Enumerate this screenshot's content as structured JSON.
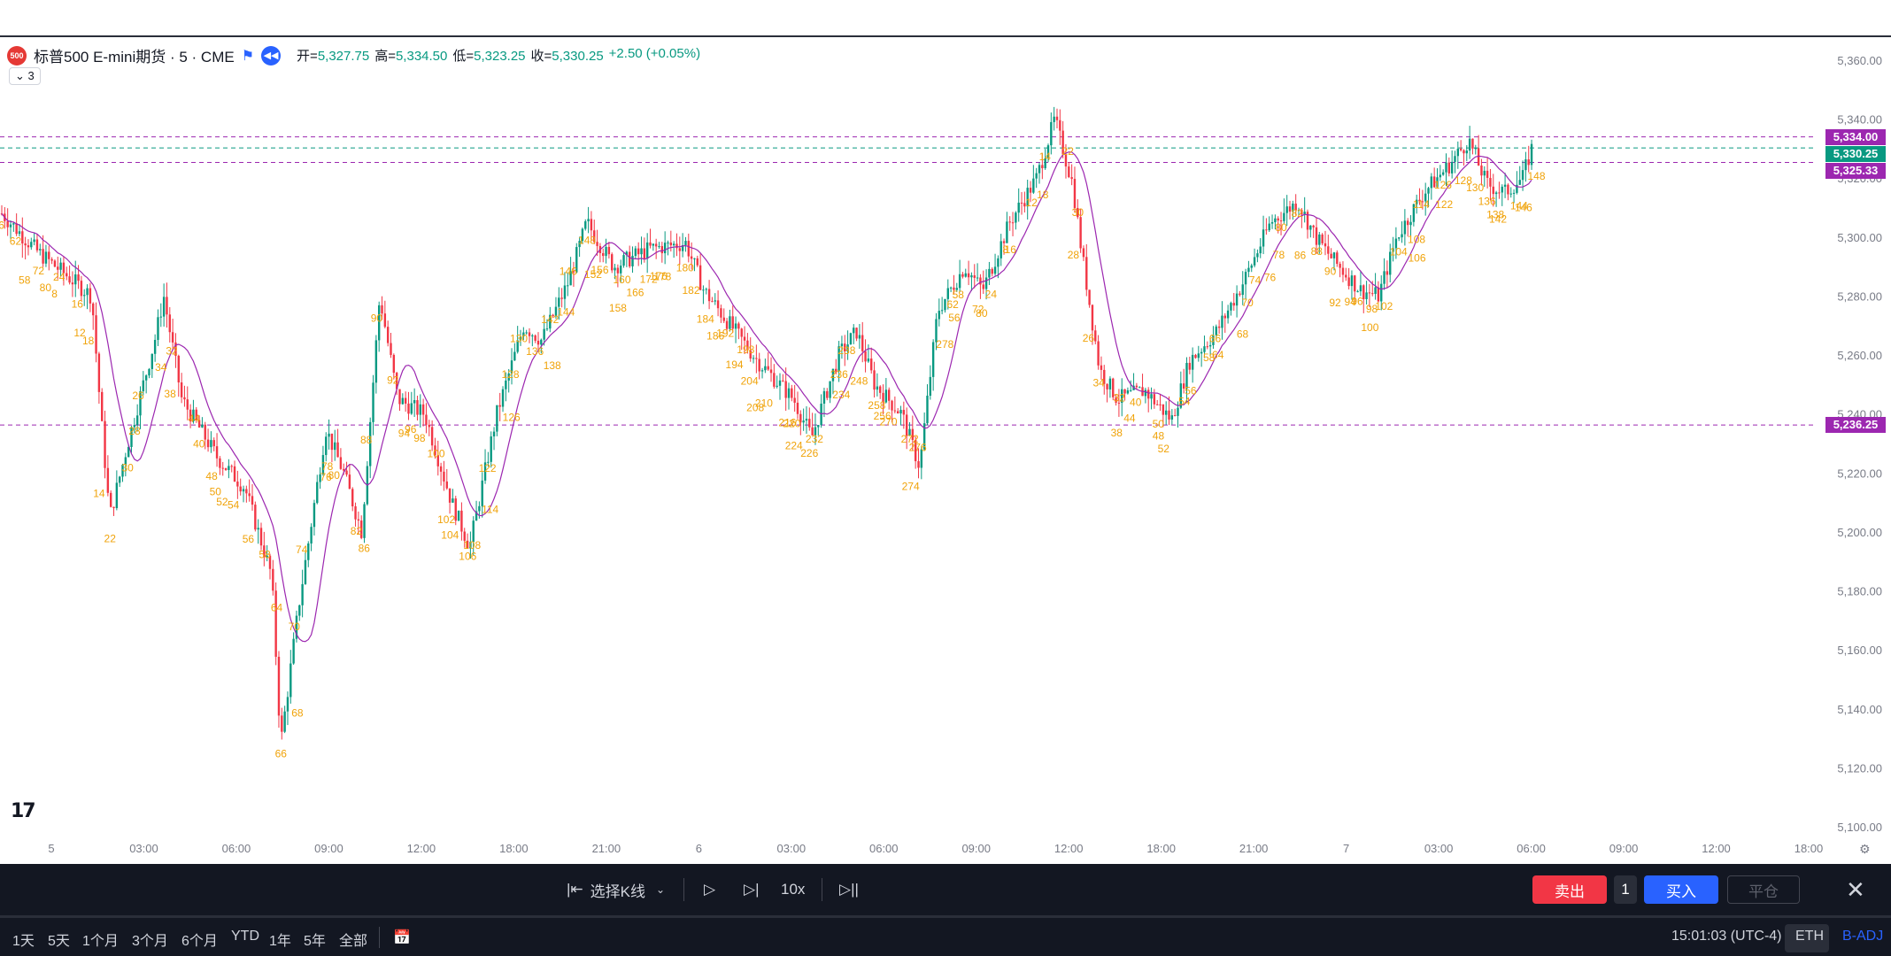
{
  "legend": {
    "symbol_badge": "500",
    "symbol_title": "标普500 E-mini期货 · 5 · CME",
    "open_label": "开=",
    "open": "5,327.75",
    "high_label": "高=",
    "high": "5,334.50",
    "low_label": "低=",
    "low": "5,323.25",
    "close_label": "收=",
    "close": "5,330.25",
    "change": "+2.50 (+0.05%)",
    "indicator_toggle": "⌄ 3"
  },
  "chart_data": {
    "type": "candlestick",
    "symbol": "标普500 E-mini期货",
    "interval": "5",
    "exchange": "CME",
    "y_axis_ticks": [
      "5,360.00",
      "5,340.00",
      "5,320.00",
      "5,300.00",
      "5,280.00",
      "5,260.00",
      "5,240.00",
      "5,220.00",
      "5,200.00",
      "5,180.00",
      "5,160.00",
      "5,140.00",
      "5,120.00",
      "5,100.00"
    ],
    "y_tick_values": [
      5360,
      5340,
      5320,
      5300,
      5280,
      5260,
      5240,
      5220,
      5200,
      5180,
      5160,
      5140,
      5120,
      5100
    ],
    "ylim": [
      5100,
      5360
    ],
    "x_axis_ticks": [
      "5",
      "03:00",
      "06:00",
      "09:00",
      "12:00",
      "18:00",
      "21:00",
      "6",
      "03:00",
      "06:00",
      "09:00",
      "12:00",
      "18:00",
      "21:00",
      "7",
      "03:00",
      "06:00",
      "09:00",
      "12:00",
      "18:00"
    ],
    "price_key_points": [
      [
        0,
        5308
      ],
      [
        0.02,
        5295
      ],
      [
        0.05,
        5280
      ],
      [
        0.055,
        5240
      ],
      [
        0.06,
        5205
      ],
      [
        0.07,
        5230
      ],
      [
        0.085,
        5265
      ],
      [
        0.09,
        5280
      ],
      [
        0.1,
        5245
      ],
      [
        0.12,
        5225
      ],
      [
        0.135,
        5215
      ],
      [
        0.15,
        5185
      ],
      [
        0.155,
        5128
      ],
      [
        0.165,
        5175
      ],
      [
        0.18,
        5235
      ],
      [
        0.19,
        5220
      ],
      [
        0.2,
        5200
      ],
      [
        0.21,
        5280
      ],
      [
        0.22,
        5245
      ],
      [
        0.235,
        5240
      ],
      [
        0.25,
        5210
      ],
      [
        0.26,
        5195
      ],
      [
        0.275,
        5240
      ],
      [
        0.29,
        5270
      ],
      [
        0.3,
        5265
      ],
      [
        0.315,
        5285
      ],
      [
        0.325,
        5305
      ],
      [
        0.34,
        5290
      ],
      [
        0.36,
        5296
      ],
      [
        0.38,
        5298
      ],
      [
        0.39,
        5282
      ],
      [
        0.405,
        5270
      ],
      [
        0.42,
        5258
      ],
      [
        0.44,
        5245
      ],
      [
        0.45,
        5232
      ],
      [
        0.465,
        5260
      ],
      [
        0.475,
        5268
      ],
      [
        0.485,
        5250
      ],
      [
        0.5,
        5240
      ],
      [
        0.51,
        5222
      ],
      [
        0.52,
        5275
      ],
      [
        0.535,
        5290
      ],
      [
        0.545,
        5282
      ],
      [
        0.56,
        5305
      ],
      [
        0.575,
        5320
      ],
      [
        0.585,
        5340
      ],
      [
        0.595,
        5318
      ],
      [
        0.6,
        5295
      ],
      [
        0.61,
        5255
      ],
      [
        0.62,
        5245
      ],
      [
        0.635,
        5248
      ],
      [
        0.65,
        5238
      ],
      [
        0.66,
        5258
      ],
      [
        0.675,
        5268
      ],
      [
        0.69,
        5285
      ],
      [
        0.705,
        5305
      ],
      [
        0.72,
        5312
      ],
      [
        0.73,
        5300
      ],
      [
        0.74,
        5292
      ],
      [
        0.755,
        5282
      ],
      [
        0.765,
        5280
      ],
      [
        0.775,
        5300
      ],
      [
        0.79,
        5315
      ],
      [
        0.805,
        5325
      ],
      [
        0.815,
        5333
      ],
      [
        0.825,
        5318
      ],
      [
        0.835,
        5315
      ],
      [
        0.845,
        5320
      ],
      [
        0.85,
        5330
      ]
    ],
    "horizontal_levels": [
      {
        "label": "5,334.00",
        "value": 5334,
        "color": "#9c27b0"
      },
      {
        "label": "5,330.25",
        "value": 5330.25,
        "color": "#089981"
      },
      {
        "label": "5,325.33",
        "value": 5325.33,
        "color": "#9c27b0"
      },
      {
        "label": "5,236.25",
        "value": 5236.25,
        "color": "#9c27b0"
      }
    ],
    "moving_average_color": "#9c27b0",
    "footprint_label_color": "#f0a30a",
    "footprint_labels": [
      "56",
      "62",
      "58",
      "72",
      "80",
      "24",
      "8",
      "16",
      "12",
      "18",
      "14",
      "22",
      "30",
      "28",
      "26",
      "34",
      "32",
      "38",
      "44",
      "40",
      "48",
      "50",
      "52",
      "54",
      "56",
      "58",
      "64",
      "66",
      "68",
      "70",
      "74",
      "76",
      "78",
      "80",
      "82",
      "86",
      "88",
      "90",
      "92",
      "94",
      "96",
      "98",
      "100",
      "102",
      "104",
      "106",
      "108",
      "114",
      "122",
      "126",
      "128",
      "130",
      "136",
      "138",
      "142",
      "144",
      "146",
      "148",
      "152",
      "156",
      "158",
      "160",
      "166",
      "172",
      "176",
      "178",
      "180",
      "182",
      "184",
      "186",
      "192",
      "194",
      "198",
      "204",
      "208",
      "210",
      "216",
      "220",
      "224",
      "226",
      "232",
      "234",
      "236",
      "238",
      "248",
      "256",
      "258",
      "270",
      "272",
      "274",
      "276",
      "278"
    ]
  },
  "replay": {
    "select_bar": "选择K线",
    "speed": "10x",
    "sell": "卖出",
    "qty": "1",
    "buy": "买入",
    "close_position": "平仓"
  },
  "timeframes": [
    "1天",
    "5天",
    "1个月",
    "3个月",
    "6个月",
    "YTD",
    "1年",
    "5年",
    "全部"
  ],
  "status": {
    "time": "15:01:03 (UTC-4)",
    "eth": "ETH",
    "adj": "B-ADJ"
  },
  "colors": {
    "up": "#089981",
    "down": "#f23645",
    "accent": "#2962ff",
    "sell": "#f23645",
    "buy": "#2962ff"
  }
}
